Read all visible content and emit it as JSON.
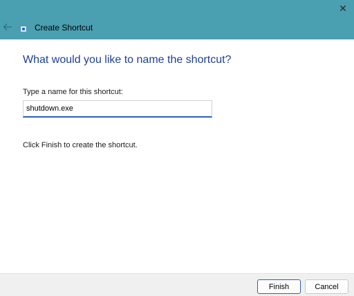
{
  "window": {
    "title": "Create Shortcut",
    "close_glyph": "✕",
    "back_icon": "back-arrow-icon",
    "app_icon": "shortcut-icon"
  },
  "main": {
    "heading": "What would you like to name the shortcut?",
    "field_label": "Type a name for this shortcut:",
    "name_value": "shutdown.exe",
    "hint": "Click Finish to create the shortcut."
  },
  "footer": {
    "finish_label": "Finish",
    "cancel_label": "Cancel"
  },
  "colors": {
    "titlebar": "#4a9fb0",
    "heading": "#1c3f9a",
    "accent": "#2b5fb8"
  }
}
